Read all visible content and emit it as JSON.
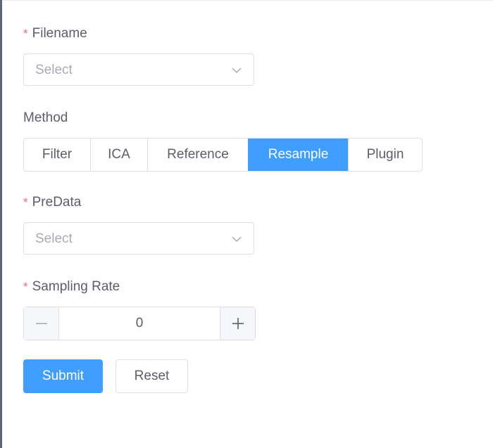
{
  "form": {
    "filename": {
      "label": "Filename",
      "required_mark": "*",
      "placeholder": "Select",
      "icon": "chevron-down-icon"
    },
    "method": {
      "label": "Method",
      "options": [
        "Filter",
        "ICA",
        "Reference",
        "Resample",
        "Plugin"
      ],
      "selected": "Resample"
    },
    "predata": {
      "label": "PreData",
      "required_mark": "*",
      "placeholder": "Select",
      "icon": "chevron-down-icon"
    },
    "sampling_rate": {
      "label": "Sampling Rate",
      "required_mark": "*",
      "value": "0",
      "decrement_icon": "minus-icon",
      "increment_icon": "plus-icon"
    },
    "actions": {
      "submit_label": "Submit",
      "reset_label": "Reset"
    }
  },
  "colors": {
    "primary": "#409eff",
    "required": "#f56c6c",
    "text": "#5b5e66",
    "placeholder": "#a8abb2",
    "border": "#dcdfe6"
  }
}
